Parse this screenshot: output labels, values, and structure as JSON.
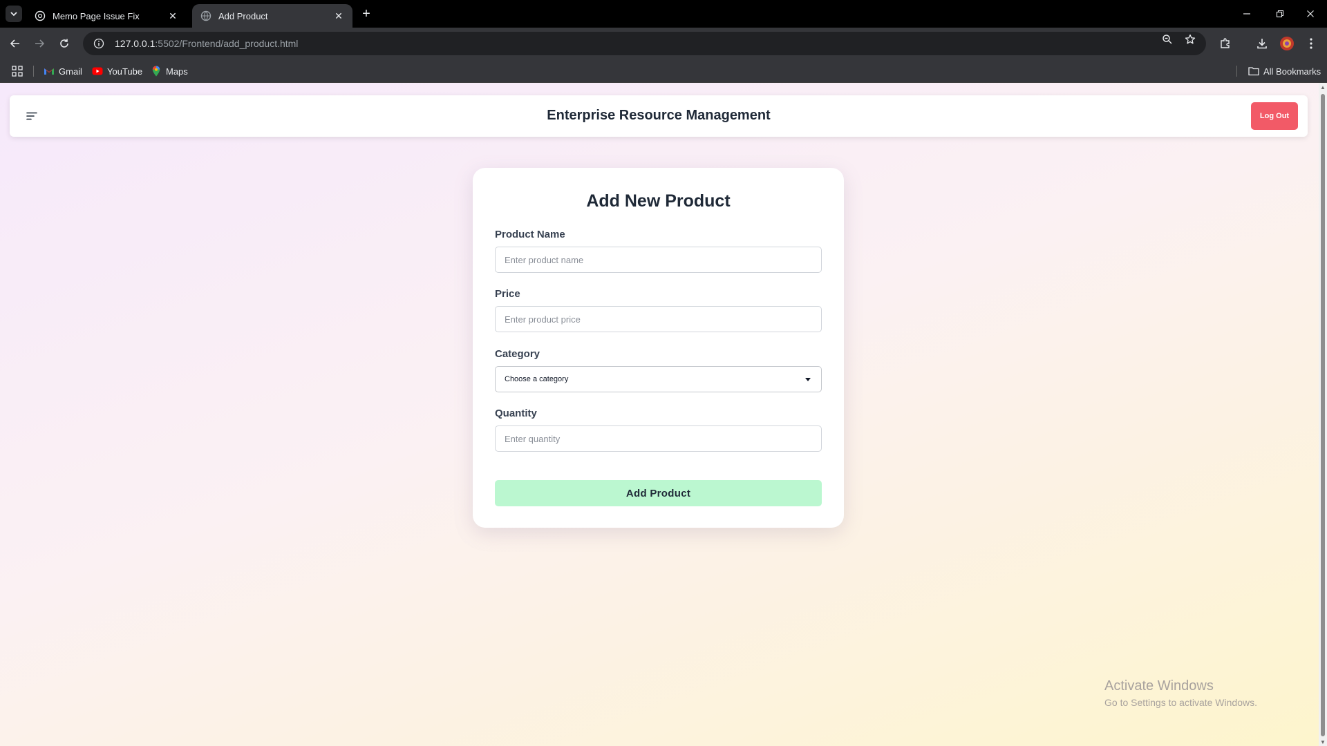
{
  "browser": {
    "tabs": [
      {
        "title": "Memo Page Issue Fix",
        "active": false
      },
      {
        "title": "Add Product",
        "active": true
      }
    ],
    "url_host": "127.0.0.1",
    "url_path": ":5502/Frontend/add_product.html",
    "bookmarks": [
      {
        "label": "Gmail",
        "icon": "gmail-icon"
      },
      {
        "label": "YouTube",
        "icon": "youtube-icon"
      },
      {
        "label": "Maps",
        "icon": "maps-icon"
      }
    ],
    "all_bookmarks_label": "All Bookmarks"
  },
  "header": {
    "title": "Enterprise Resource Management",
    "logout_label": "Log Out"
  },
  "form": {
    "title": "Add New Product",
    "fields": [
      {
        "label": "Product Name",
        "placeholder": "Enter product name",
        "value": ""
      },
      {
        "label": "Price",
        "placeholder": "Enter product price",
        "value": ""
      },
      {
        "label": "Category",
        "selected": "Choose a category"
      },
      {
        "label": "Quantity",
        "placeholder": "Enter quantity",
        "value": ""
      }
    ],
    "submit_label": "Add Product"
  },
  "watermark": {
    "title": "Activate Windows",
    "subtitle": "Go to Settings to activate Windows."
  },
  "colors": {
    "logout_bg": "#f25a67",
    "submit_bg": "#bbf7d0",
    "page_gradient_start": "#f6e9fb",
    "page_gradient_end": "#fdf5cc"
  }
}
